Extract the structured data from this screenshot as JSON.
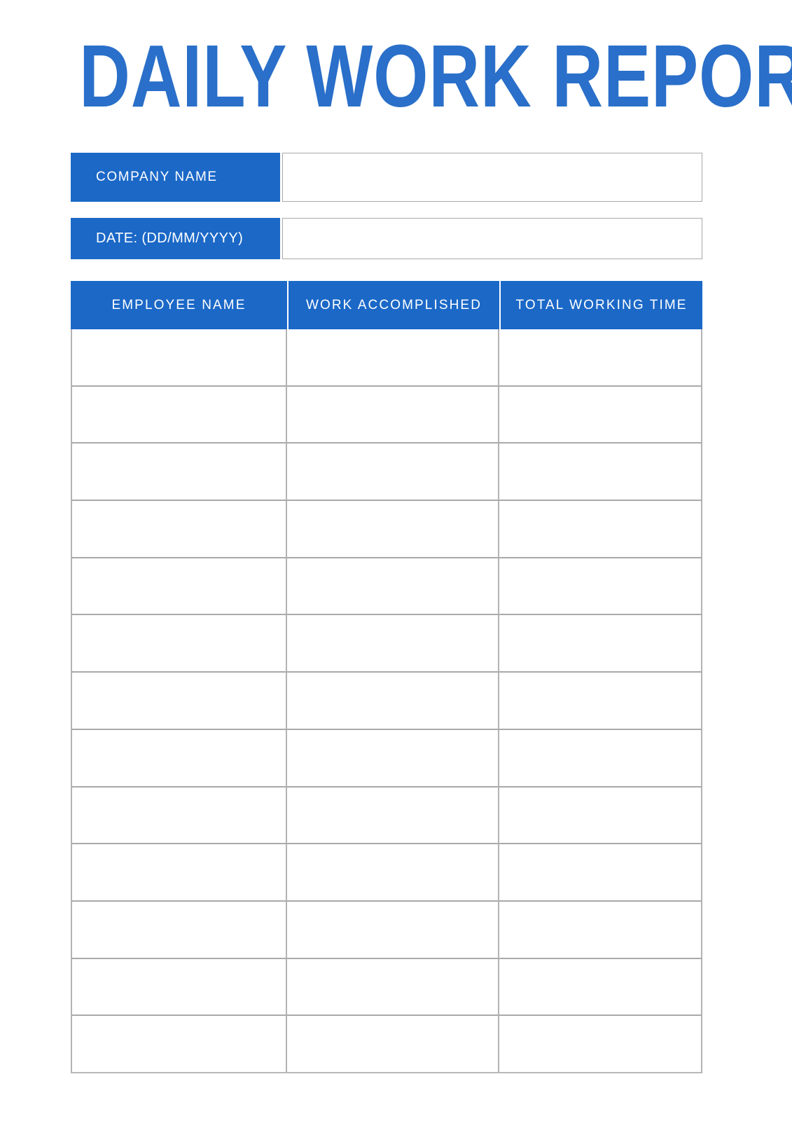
{
  "document": {
    "title": "DAILY WORK REPORT",
    "accent_color": "#1b68c7",
    "title_color": "#2a6fc9",
    "grid_color": "#a9a9a9",
    "background_color": "#ffffff"
  },
  "fields": [
    {
      "label": "COMPANY NAME",
      "value": "",
      "placeholder": ""
    },
    {
      "label": "DATE: (DD/MM/YYYY)",
      "value": "",
      "placeholder": ""
    }
  ],
  "table": {
    "columns": [
      "EMPLOYEE NAME",
      "WORK ACCOMPLISHED",
      "TOTAL WORKING TIME"
    ],
    "row_count": 13,
    "rows": [
      {
        "employee_name": "",
        "work_accomplished": "",
        "total_working_time": ""
      },
      {
        "employee_name": "",
        "work_accomplished": "",
        "total_working_time": ""
      },
      {
        "employee_name": "",
        "work_accomplished": "",
        "total_working_time": ""
      },
      {
        "employee_name": "",
        "work_accomplished": "",
        "total_working_time": ""
      },
      {
        "employee_name": "",
        "work_accomplished": "",
        "total_working_time": ""
      },
      {
        "employee_name": "",
        "work_accomplished": "",
        "total_working_time": ""
      },
      {
        "employee_name": "",
        "work_accomplished": "",
        "total_working_time": ""
      },
      {
        "employee_name": "",
        "work_accomplished": "",
        "total_working_time": ""
      },
      {
        "employee_name": "",
        "work_accomplished": "",
        "total_working_time": ""
      },
      {
        "employee_name": "",
        "work_accomplished": "",
        "total_working_time": ""
      },
      {
        "employee_name": "",
        "work_accomplished": "",
        "total_working_time": ""
      },
      {
        "employee_name": "",
        "work_accomplished": "",
        "total_working_time": ""
      },
      {
        "employee_name": "",
        "work_accomplished": "",
        "total_working_time": ""
      }
    ]
  }
}
